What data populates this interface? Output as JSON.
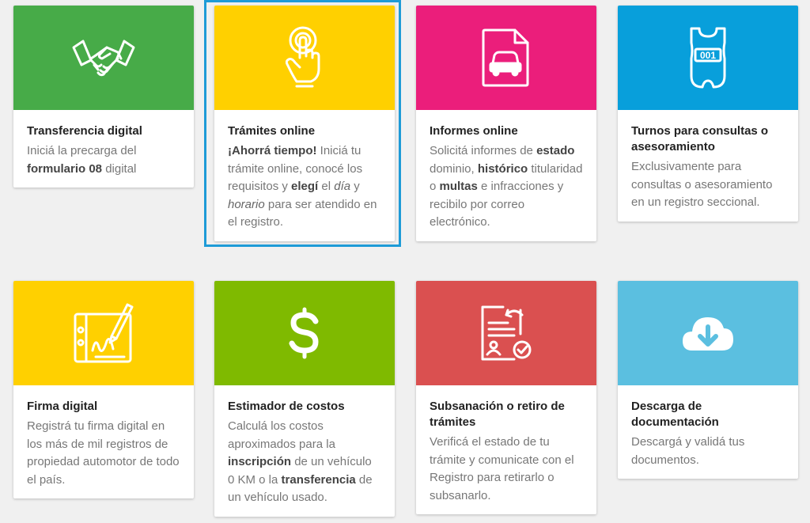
{
  "colors": {
    "green": "#47ab48",
    "yellow": "#ffd000",
    "magenta": "#eb1e7b",
    "blue": "#089fdb",
    "lime": "#7fba00",
    "red": "#da5050",
    "light_blue": "#5bbfe0",
    "selection": "#1e9bd7"
  },
  "cards": [
    {
      "title": "Transferencia digital",
      "icon": "handshake-icon",
      "desc": [
        {
          "t": "Iniciá la precarga del "
        },
        {
          "t": "formulario 08",
          "b": true
        },
        {
          "t": " digital"
        }
      ]
    },
    {
      "title": "Trámites online",
      "icon": "touch-icon",
      "desc": [
        {
          "t": "¡Ahorrá tiempo!",
          "b": true
        },
        {
          "t": " Iniciá tu trámite online, conocé los requisitos y "
        },
        {
          "t": "elegí",
          "b": true
        },
        {
          "t": " el "
        },
        {
          "t": "día",
          "i": true
        },
        {
          "t": " y "
        },
        {
          "t": "horario",
          "i": true
        },
        {
          "t": " para ser atendido en el registro."
        }
      ]
    },
    {
      "title": "Informes online",
      "icon": "car-document-icon",
      "desc": [
        {
          "t": "Solicitá informes de "
        },
        {
          "t": "estado",
          "b": true
        },
        {
          "t": " dominio, "
        },
        {
          "t": "histórico",
          "b": true
        },
        {
          "t": " titularidad o "
        },
        {
          "t": "multas",
          "b": true
        },
        {
          "t": " e infracciones y recibilo por correo electrónico."
        }
      ]
    },
    {
      "title": "Turnos para consultas o asesoramiento",
      "icon": "ticket-icon",
      "ticket_number": "001",
      "desc": [
        {
          "t": "Exclusivamente para consultas o asesoramiento en un registro seccional."
        }
      ]
    },
    {
      "title": "Firma digital",
      "icon": "signature-tablet-icon",
      "desc": [
        {
          "t": "Registrá tu firma digital en los más de mil registros de propiedad automotor de todo el país."
        }
      ]
    },
    {
      "title": "Estimador de costos",
      "icon": "dollar-icon",
      "desc": [
        {
          "t": "Calculá los costos aproximados para la "
        },
        {
          "t": "inscripción",
          "b": true
        },
        {
          "t": " de un vehículo 0 KM o la "
        },
        {
          "t": "transferencia",
          "b": true
        },
        {
          "t": " de un vehículo usado."
        }
      ]
    },
    {
      "title": "Subsanación o retiro de trámites",
      "icon": "certificate-check-icon",
      "desc": [
        {
          "t": "Verificá el estado de tu trámite y comunicate con el Registro para retirarlo o subsanarlo."
        }
      ]
    },
    {
      "title": "Descarga de documentación",
      "icon": "cloud-download-icon",
      "desc": [
        {
          "t": "Descargá y validá tus documentos."
        }
      ]
    }
  ]
}
